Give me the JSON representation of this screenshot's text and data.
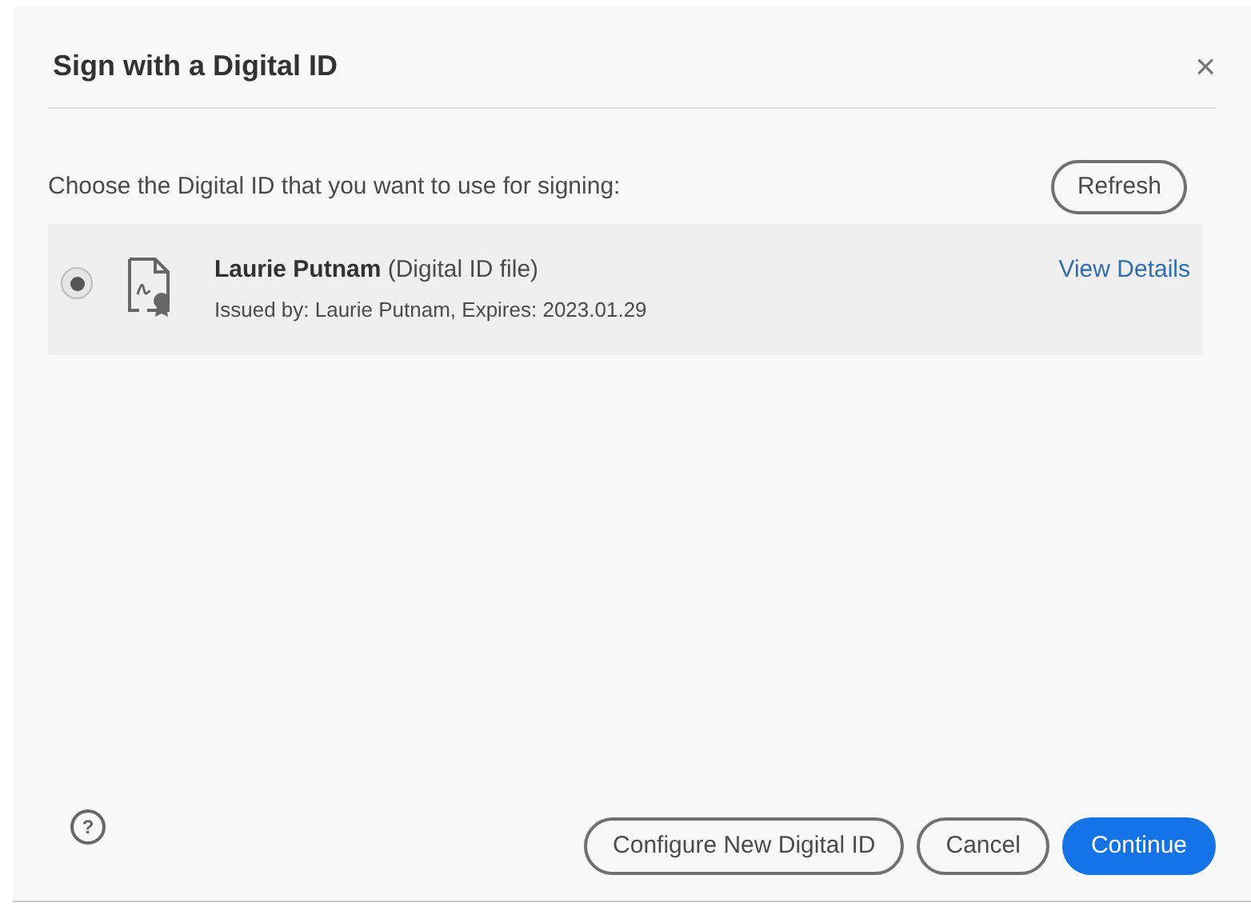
{
  "dialog": {
    "title": "Sign with a Digital ID",
    "close": "×"
  },
  "prompt": "Choose the Digital ID that you want to use for signing:",
  "refresh_button": "Refresh",
  "ids": [
    {
      "name": "Laurie Putnam",
      "type": "(Digital ID file)",
      "issued": "Issued by: Laurie Putnam, Expires: 2023.01.29",
      "link": "View Details",
      "selected": true
    }
  ],
  "footer": {
    "help": "?",
    "buttons": [
      {
        "label": "Configure New Digital ID",
        "kind": "outline"
      },
      {
        "label": "Cancel",
        "kind": "outline"
      },
      {
        "label": "Continue",
        "kind": "primary"
      }
    ]
  }
}
